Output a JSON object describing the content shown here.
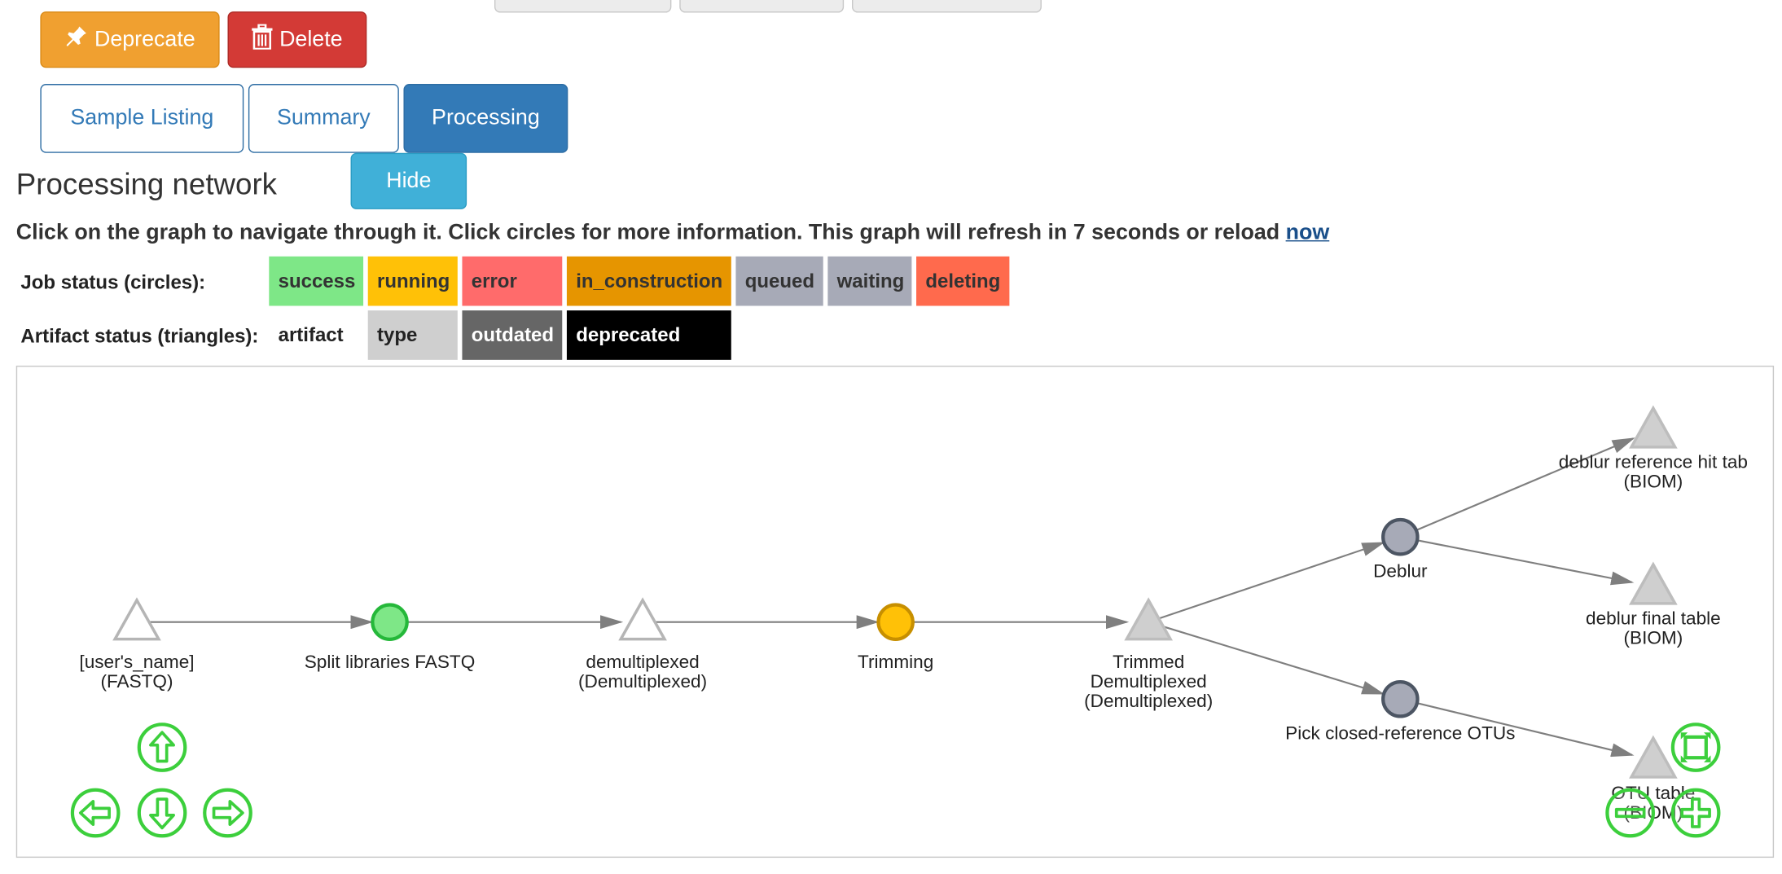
{
  "toolbar": {
    "deprecate_label": "Deprecate",
    "delete_label": "Delete"
  },
  "tabs": [
    {
      "label": "Sample Listing",
      "active": false
    },
    {
      "label": "Summary",
      "active": false
    },
    {
      "label": "Processing",
      "active": true
    }
  ],
  "section": {
    "title": "Processing network",
    "hide_label": "Hide",
    "instructions": "Click on the graph to navigate through it. Click circles for more information. This graph will refresh in 7 seconds or reload",
    "reload_link": "now"
  },
  "legend": {
    "job_label": "Job status (circles):",
    "job_statuses": [
      {
        "label": "success",
        "color": "#7ee787"
      },
      {
        "label": "running",
        "color": "#ffc107"
      },
      {
        "label": "error",
        "color": "#ff6b6b"
      },
      {
        "label": "in_construction",
        "color": "#e69500"
      },
      {
        "label": "queued",
        "color": "#a7aab7"
      },
      {
        "label": "waiting",
        "color": "#a7aab7"
      },
      {
        "label": "deleting",
        "color": "#ff6a4d"
      }
    ],
    "artifact_label": "Artifact status (triangles):",
    "artifact_statuses": [
      {
        "label": "artifact",
        "color": "#ffffff",
        "text_color": "#222222"
      },
      {
        "label": "type",
        "color": "#cfcfcf",
        "text_color": "#222222"
      },
      {
        "label": "outdated",
        "color": "#666666",
        "text_color": "#ffffff"
      },
      {
        "label": "deprecated",
        "color": "#000000",
        "text_color": "#ffffff"
      }
    ]
  },
  "graph": {
    "nodes": [
      {
        "id": "n1",
        "shape": "triangle",
        "fill": "#ffffff",
        "stroke": "#b5b5b5",
        "label": "[user's_name]\n(FASTQ)"
      },
      {
        "id": "n2",
        "shape": "circle",
        "fill": "#7ee787",
        "stroke": "#25b83a",
        "label": "Split libraries FASTQ"
      },
      {
        "id": "n3",
        "shape": "triangle",
        "fill": "#ffffff",
        "stroke": "#b5b5b5",
        "label": "demultiplexed\n(Demultiplexed)"
      },
      {
        "id": "n4",
        "shape": "circle",
        "fill": "#ffc107",
        "stroke": "#c78f00",
        "label": "Trimming"
      },
      {
        "id": "n5",
        "shape": "triangle",
        "fill": "#cfcfcf",
        "stroke": "#bdbdbd",
        "label": "Trimmed\nDemultiplexed\n(Demultiplexed)"
      },
      {
        "id": "n6",
        "shape": "circle",
        "fill": "#a7aab7",
        "stroke": "#4c5563",
        "label": "Deblur"
      },
      {
        "id": "n7",
        "shape": "circle",
        "fill": "#a7aab7",
        "stroke": "#4c5563",
        "label": "Pick closed-reference OTUs"
      },
      {
        "id": "n8",
        "shape": "triangle",
        "fill": "#cfcfcf",
        "stroke": "#bdbdbd",
        "label": "deblur reference hit tab\n(BIOM)"
      },
      {
        "id": "n9",
        "shape": "triangle",
        "fill": "#cfcfcf",
        "stroke": "#bdbdbd",
        "label": "deblur final table\n(BIOM)"
      },
      {
        "id": "n10",
        "shape": "triangle",
        "fill": "#cfcfcf",
        "stroke": "#bdbdbd",
        "label": "OTU table\n(BIOM)"
      }
    ],
    "edges": [
      [
        "n1",
        "n2"
      ],
      [
        "n2",
        "n3"
      ],
      [
        "n3",
        "n4"
      ],
      [
        "n4",
        "n5"
      ],
      [
        "n5",
        "n6"
      ],
      [
        "n5",
        "n7"
      ],
      [
        "n6",
        "n8"
      ],
      [
        "n6",
        "n9"
      ],
      [
        "n7",
        "n10"
      ]
    ],
    "controls": [
      {
        "name": "pan-up-icon"
      },
      {
        "name": "pan-left-icon"
      },
      {
        "name": "pan-down-icon"
      },
      {
        "name": "pan-right-icon"
      },
      {
        "name": "fit-view-icon"
      },
      {
        "name": "zoom-out-icon"
      },
      {
        "name": "zoom-in-icon"
      }
    ],
    "edge_color": "#7f7f7f",
    "control_color": "#3ccf3c"
  }
}
